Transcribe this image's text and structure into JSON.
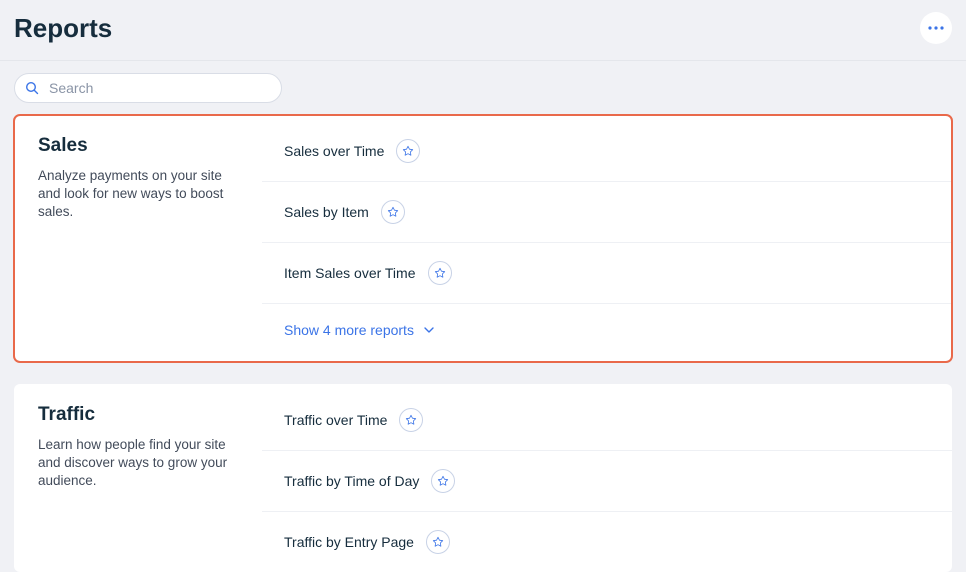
{
  "page_title": "Reports",
  "search": {
    "placeholder": "Search"
  },
  "sections": [
    {
      "title": "Sales",
      "desc": "Analyze payments on your site and look for new ways to boost sales.",
      "reports": [
        {
          "name": "Sales over Time"
        },
        {
          "name": "Sales by Item"
        },
        {
          "name": "Item Sales over Time"
        }
      ],
      "show_more": "Show 4 more reports",
      "highlight": true
    },
    {
      "title": "Traffic",
      "desc": "Learn how people find your site and discover ways to grow your audience.",
      "reports": [
        {
          "name": "Traffic over Time"
        },
        {
          "name": "Traffic by Time of Day"
        },
        {
          "name": "Traffic by Entry Page"
        }
      ],
      "highlight": false
    }
  ]
}
